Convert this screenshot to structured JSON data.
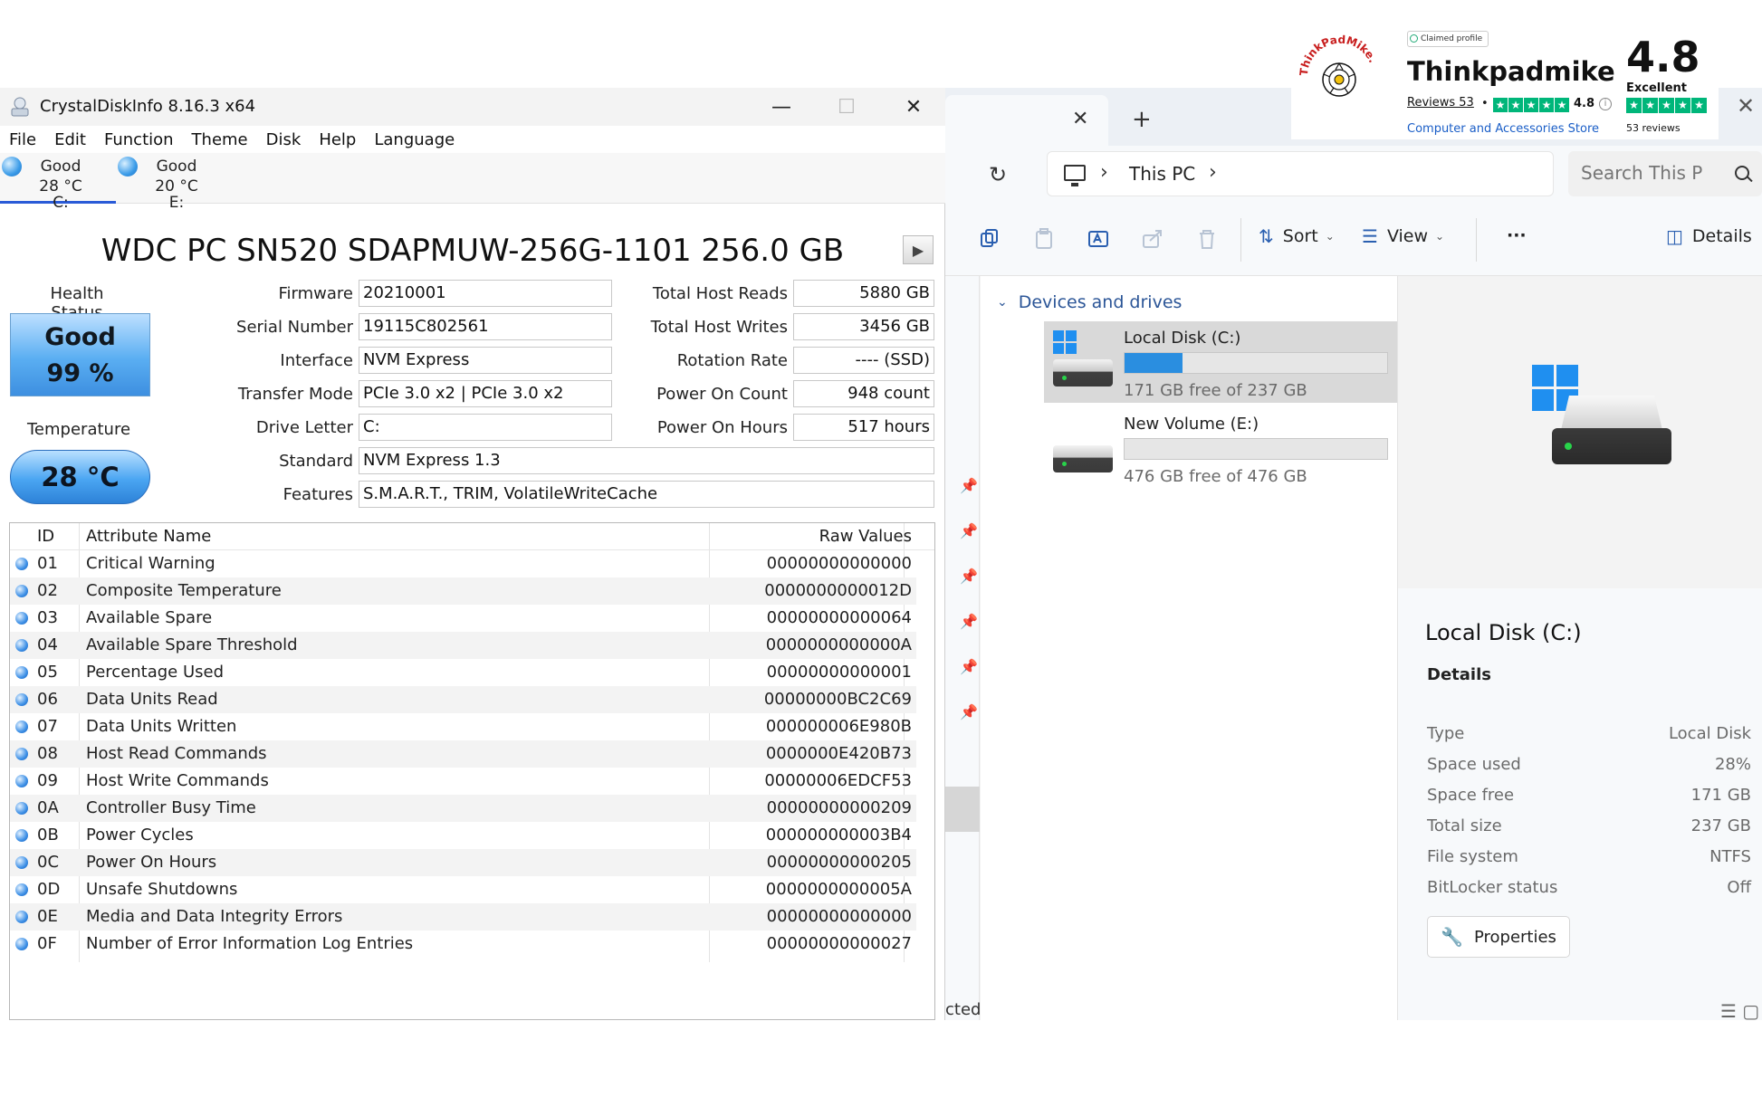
{
  "crystaldisk": {
    "title": "CrystalDiskInfo 8.16.3 x64",
    "window_controls": {
      "minimize": "—",
      "maximize": "☐",
      "close": "✕"
    },
    "menu": [
      "File",
      "Edit",
      "Function",
      "Theme",
      "Disk",
      "Help",
      "Language"
    ],
    "drives": [
      {
        "status": "Good",
        "temp": "28 °C",
        "letter": "C:"
      },
      {
        "status": "Good",
        "temp": "20 °C",
        "letter": "E:"
      }
    ],
    "disk_title": "WDC PC SN520 SDAPMUW-256G-1101 256.0 GB",
    "play_icon": "▶",
    "health": {
      "label": "Health Status",
      "status": "Good",
      "percent": "99 %"
    },
    "temperature": {
      "label": "Temperature",
      "value": "28 °C"
    },
    "info": {
      "firmware_label": "Firmware",
      "firmware": "20210001",
      "serial_label": "Serial Number",
      "serial": "19115C802561",
      "interface_label": "Interface",
      "interface": "NVM Express",
      "transfer_label": "Transfer Mode",
      "transfer": "PCIe 3.0 x2 | PCIe 3.0 x2",
      "drive_letter_label": "Drive Letter",
      "drive_letter": "C:",
      "standard_label": "Standard",
      "standard": "NVM Express 1.3",
      "features_label": "Features",
      "features": "S.M.A.R.T., TRIM, VolatileWriteCache",
      "host_reads_label": "Total Host Reads",
      "host_reads": "5880 GB",
      "host_writes_label": "Total Host Writes",
      "host_writes": "3456 GB",
      "rotation_label": "Rotation Rate",
      "rotation": "---- (SSD)",
      "power_count_label": "Power On Count",
      "power_count": "948 count",
      "power_hours_label": "Power On Hours",
      "power_hours": "517 hours"
    },
    "smart": {
      "headers": {
        "id": "ID",
        "name": "Attribute Name",
        "raw": "Raw Values"
      },
      "rows": [
        {
          "id": "01",
          "name": "Critical Warning",
          "raw": "00000000000000"
        },
        {
          "id": "02",
          "name": "Composite Temperature",
          "raw": "0000000000012D"
        },
        {
          "id": "03",
          "name": "Available Spare",
          "raw": "00000000000064"
        },
        {
          "id": "04",
          "name": "Available Spare Threshold",
          "raw": "0000000000000A"
        },
        {
          "id": "05",
          "name": "Percentage Used",
          "raw": "00000000000001"
        },
        {
          "id": "06",
          "name": "Data Units Read",
          "raw": "00000000BC2C69"
        },
        {
          "id": "07",
          "name": "Data Units Written",
          "raw": "000000006E980B"
        },
        {
          "id": "08",
          "name": "Host Read Commands",
          "raw": "0000000E420B73"
        },
        {
          "id": "09",
          "name": "Host Write Commands",
          "raw": "00000006EDCF53"
        },
        {
          "id": "0A",
          "name": "Controller Busy Time",
          "raw": "00000000000209"
        },
        {
          "id": "0B",
          "name": "Power Cycles",
          "raw": "000000000003B4"
        },
        {
          "id": "0C",
          "name": "Power On Hours",
          "raw": "00000000000205"
        },
        {
          "id": "0D",
          "name": "Unsafe Shutdowns",
          "raw": "0000000000005A"
        },
        {
          "id": "0E",
          "name": "Media and Data Integrity Errors",
          "raw": "00000000000000"
        },
        {
          "id": "0F",
          "name": "Number of Error Information Log Entries",
          "raw": "00000000000027"
        }
      ]
    }
  },
  "explorer": {
    "tab_close": "✕",
    "tab_new": "+",
    "window_close": "✕",
    "refresh_icon": "↻",
    "breadcrumb": {
      "location": "This PC",
      "chevron": "›"
    },
    "search": {
      "placeholder": "Search This P"
    },
    "toolbar": {
      "sort_label": "Sort",
      "view_label": "View",
      "more_label": "···",
      "details_label": "Details"
    },
    "group": {
      "label": "Devices and drives",
      "chevron": "⌄"
    },
    "drives": [
      {
        "name": "Local Disk (C:)",
        "free_text": "171 GB free of 237 GB",
        "used_fraction": 0.22
      },
      {
        "name": "New Volume (E:)",
        "free_text": "476 GB free of 476 GB",
        "used_fraction": 0.0
      }
    ],
    "status_text": "cted",
    "details": {
      "title": "Local Disk (C:)",
      "section": "Details",
      "rows": [
        {
          "key": "Type",
          "value": "Local Disk"
        },
        {
          "key": "Space used",
          "value": "28%"
        },
        {
          "key": "Space free",
          "value": "171 GB"
        },
        {
          "key": "Total size",
          "value": "237 GB"
        },
        {
          "key": "File system",
          "value": "NTFS"
        },
        {
          "key": "BitLocker status",
          "value": "Off"
        }
      ],
      "properties_label": "Properties"
    }
  },
  "trustpilot": {
    "seal_text": "ThinkPadMike.com",
    "claimed": "Claimed profile",
    "brand": "Thinkpadmike",
    "reviews_link": "Reviews 53",
    "bullet": "•",
    "small_rating": "4.8",
    "info": "i",
    "category": "Computer and Accessories Store",
    "rating": "4.8",
    "rating_word": "Excellent",
    "review_count": "53 reviews",
    "star_color": "#00b67a"
  }
}
